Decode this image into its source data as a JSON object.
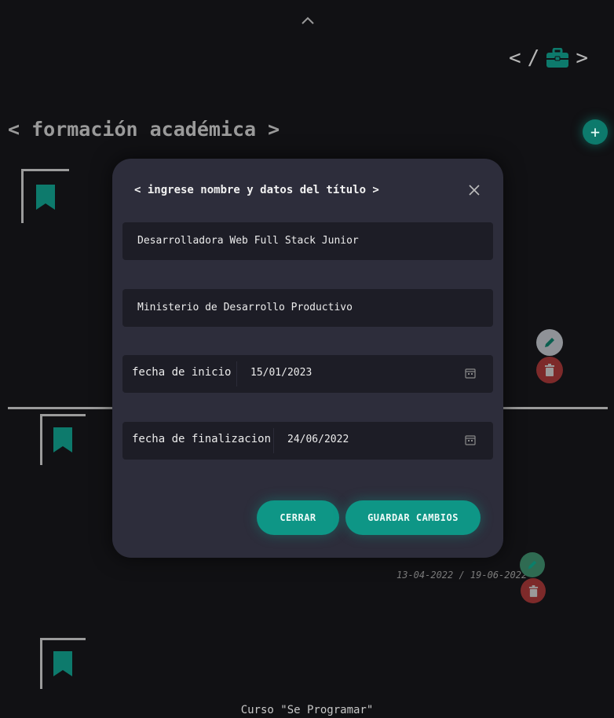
{
  "nav": {
    "left_bracket": "<",
    "slash": "/",
    "right_bracket": ">"
  },
  "section": {
    "title": "< formación académica >",
    "add_symbol": "+"
  },
  "entries": [
    {
      "dates": "13-04-2022 / 19-06-2022"
    }
  ],
  "entry_partial_dates": "2022",
  "footer": {
    "course": "Curso \"Se Programar\""
  },
  "modal": {
    "title": "< ingrese nombre y datos del título >",
    "name_value": "Desarrolladora Web Full Stack Junior",
    "institution_value": "Ministerio de Desarrollo Productivo",
    "start_label": "fecha de inicio",
    "start_value": "15/01/2023",
    "end_label": "fecha de finalizacion",
    "end_value": "24/06/2022",
    "close_button": "CERRAR",
    "save_button": "GUARDAR CAMBIOS"
  },
  "colors": {
    "accent": "#0e9686",
    "background": "#111114",
    "modal": "#2d2d3b",
    "delete": "#7d2a2a"
  },
  "icons": [
    "chevron-up-icon",
    "briefcase-icon",
    "plus-icon",
    "bookmark-icon",
    "pencil-icon",
    "trash-icon",
    "close-icon",
    "calendar-icon"
  ]
}
